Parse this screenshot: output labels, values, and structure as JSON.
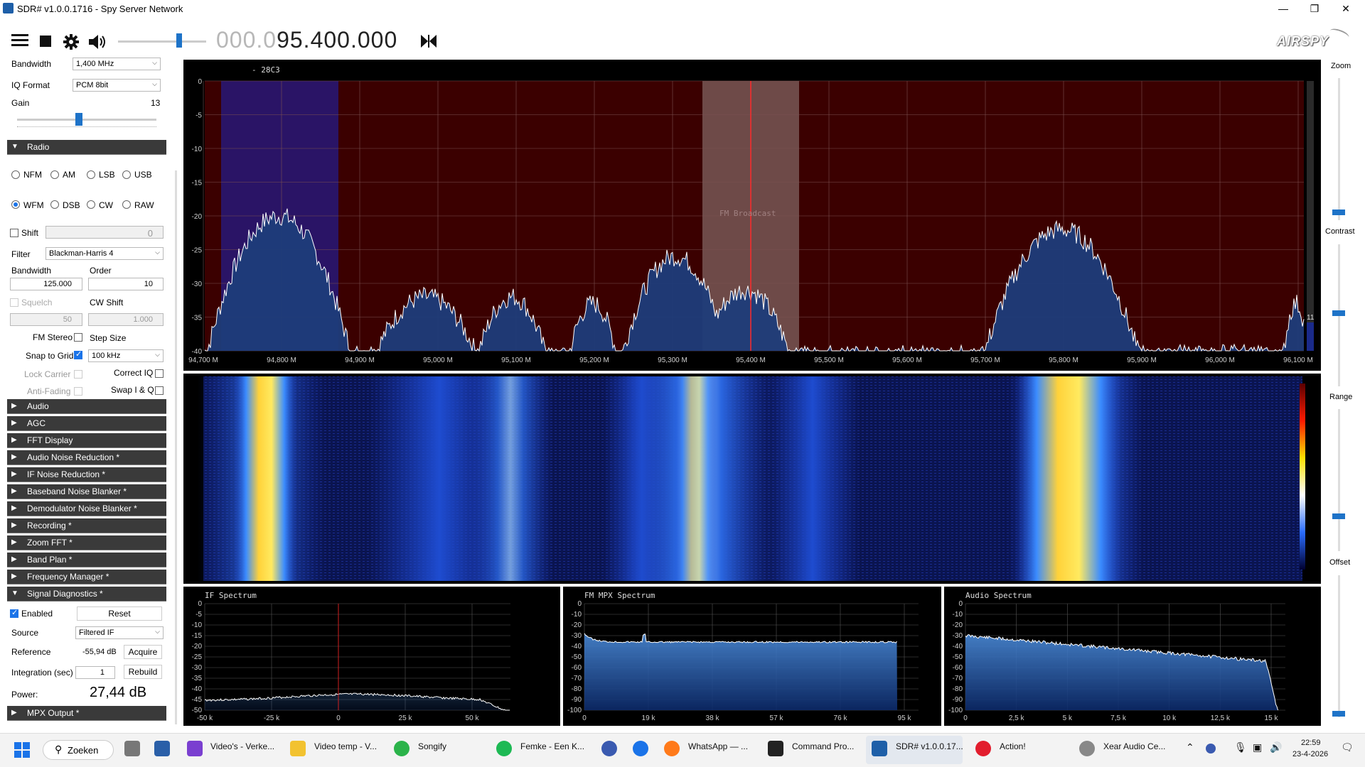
{
  "window": {
    "title": "SDR# v1.0.0.1716 - Spy Server Network"
  },
  "toolbar": {
    "freq_dim": "000.0",
    "freq_bright": "95.400.000",
    "logo": "AIRSPY"
  },
  "source": {
    "bandwidth_label": "Bandwidth",
    "bandwidth_value": "1,400 MHz",
    "iq_label": "IQ Format",
    "iq_value": "PCM 8bit",
    "gain_label": "Gain",
    "gain_value": "13"
  },
  "radio": {
    "header": "Radio",
    "modes_row1": [
      "NFM",
      "AM",
      "LSB",
      "USB"
    ],
    "modes_row2": [
      "WFM",
      "DSB",
      "CW",
      "RAW"
    ],
    "shift_label": "Shift",
    "shift_value": "0",
    "filter_label": "Filter",
    "filter_value": "Blackman-Harris 4",
    "bw_label": "Bandwidth",
    "bw_value": "125.000",
    "order_label": "Order",
    "order_value": "10",
    "squelch_label": "Squelch",
    "squelch_value": "50",
    "cwshift_label": "CW Shift",
    "cwshift_value": "1.000",
    "fmstereo_label": "FM Stereo",
    "stepsize_label": "Step Size",
    "snap_label": "Snap to Grid",
    "snap_value": "100 kHz",
    "lockcarrier_label": "Lock Carrier",
    "correctiq_label": "Correct IQ",
    "antifading_label": "Anti-Fading",
    "swapiq_label": "Swap I & Q"
  },
  "sections": [
    "Audio",
    "AGC",
    "FFT Display",
    "Audio Noise Reduction *",
    "IF Noise Reduction *",
    "Baseband Noise Blanker *",
    "Demodulator Noise Blanker *",
    "Recording *",
    "Zoom FFT *",
    "Band Plan *",
    "Frequency Manager *",
    "Signal Diagnostics *"
  ],
  "diag": {
    "enabled_label": "Enabled",
    "reset_label": "Reset",
    "source_label": "Source",
    "source_value": "Filtered IF",
    "reference_label": "Reference",
    "reference_value": "-55,94 dB",
    "acquire_label": "Acquire",
    "integration_label": "Integration (sec)",
    "integration_value": "1",
    "rebuild_label": "Rebuild",
    "power_label": "Power:",
    "power_value": "27,44 dB"
  },
  "mpx_section": "MPX Output *",
  "spectrum": {
    "station": "- 28C3",
    "band_label": "FM Broadcast",
    "y_ticks": [
      "0",
      "-5",
      "-10",
      "-15",
      "-20",
      "-25",
      "-30",
      "-35",
      "-40"
    ],
    "x_ticks": [
      "94,700 M",
      "94,800 M",
      "94,900 M",
      "95,000 M",
      "95,100 M",
      "95,200 M",
      "95,300 M",
      "95,400 M",
      "95,500 M",
      "95,600 M",
      "95,700 M",
      "95,800 M",
      "95,900 M",
      "96,000 M",
      "96,100 M"
    ],
    "level_marker": "11"
  },
  "rightbar": {
    "zoom": "Zoom",
    "contrast": "Contrast",
    "range": "Range",
    "offset": "Offset"
  },
  "if_spectrum": {
    "title": "IF Spectrum",
    "y_ticks": [
      "0",
      "-5",
      "-10",
      "-15",
      "-20",
      "-25",
      "-30",
      "-35",
      "-40",
      "-45",
      "-50"
    ],
    "x_ticks": [
      "-50 k",
      "-25 k",
      "0",
      "25 k",
      "50 k"
    ]
  },
  "mpx_spectrum": {
    "title": "FM MPX Spectrum",
    "y_ticks": [
      "0",
      "-10",
      "-20",
      "-30",
      "-40",
      "-50",
      "-60",
      "-70",
      "-80",
      "-90",
      "-100"
    ],
    "x_ticks": [
      "0",
      "19 k",
      "38 k",
      "57 k",
      "76 k",
      "95 k"
    ]
  },
  "audio_spectrum": {
    "title": "Audio Spectrum",
    "y_ticks": [
      "0",
      "-10",
      "-20",
      "-30",
      "-40",
      "-50",
      "-60",
      "-70",
      "-80",
      "-90",
      "-100"
    ],
    "x_ticks": [
      "0",
      "2,5 k",
      "5 k",
      "7,5 k",
      "10 k",
      "12,5 k",
      "15 k"
    ]
  },
  "taskbar": {
    "search": "Zoeken",
    "apps": [
      "Video's - Verke...",
      "Video temp - V...",
      "Songify",
      "Femke - Een K...",
      "WhatsApp — ...",
      "Command Pro...",
      "SDR# v1.0.0.17...",
      "Action!",
      "Xear Audio Ce..."
    ],
    "time": "22:59",
    "date": "23-4-2026"
  },
  "colors": {
    "accent": "#1a73e8",
    "spectrum_bg": "#3b0000",
    "band_highlight": "#2a1466",
    "trace": "#ffffff"
  }
}
